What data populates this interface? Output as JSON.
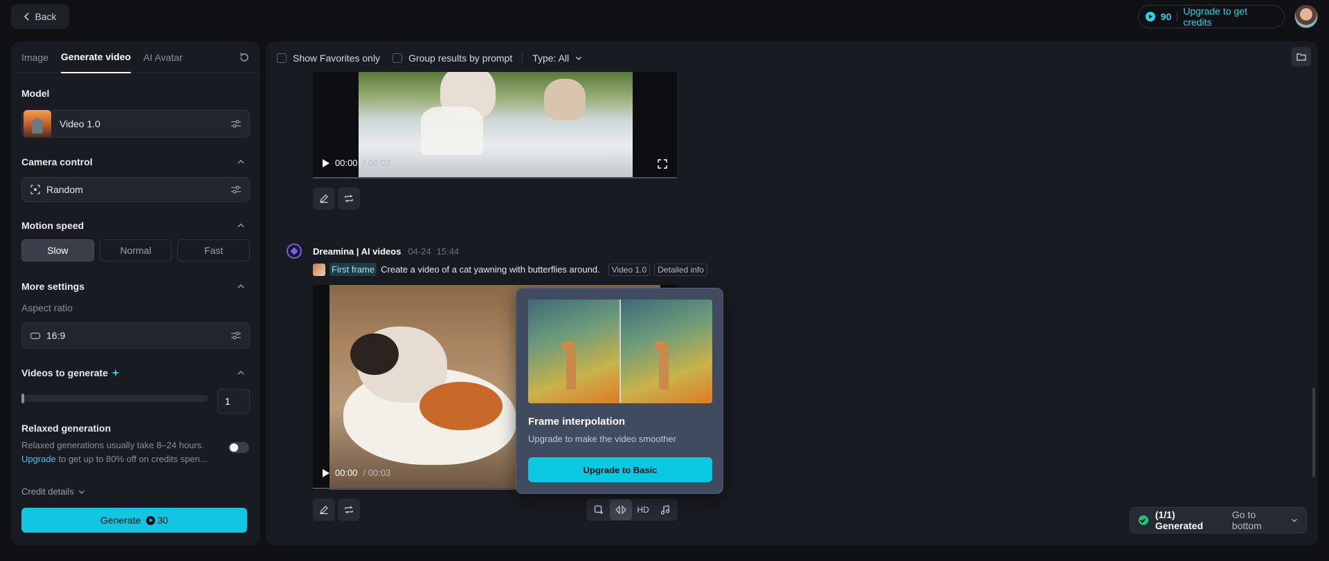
{
  "topbar": {
    "back_label": "Back",
    "credits": "90",
    "upgrade_label": "Upgrade to get credits"
  },
  "left": {
    "tabs": [
      {
        "label": "Image",
        "active": false
      },
      {
        "label": "Generate video",
        "active": true
      },
      {
        "label": "AI Avatar",
        "active": false
      }
    ],
    "model_title": "Model",
    "model_value": "Video 1.0",
    "camera_title": "Camera control",
    "camera_value": "Random",
    "speed_title": "Motion speed",
    "speed_options": [
      "Slow",
      "Normal",
      "Fast"
    ],
    "speed_selected": "Slow",
    "more_title": "More settings",
    "aspect_label": "Aspect ratio",
    "aspect_value": "16:9",
    "videos_title": "Videos to generate",
    "videos_count": "1",
    "relaxed_title": "Relaxed generation",
    "relaxed_desc": "Relaxed generations usually take 8–24 hours.",
    "relaxed_link": "Upgrade",
    "relaxed_desc2": " to get up to 80% off on credits spen...",
    "credit_details": "Credit details",
    "generate_label": "Generate",
    "generate_cost": "30"
  },
  "main": {
    "filter_favorites": "Show Favorites only",
    "filter_group": "Group results by prompt",
    "filter_type": "Type: All",
    "video1": {
      "time": "00:00",
      "duration": "/ 00:03"
    },
    "gen": {
      "name": "Dreamina | AI videos",
      "date": "04-24",
      "time": "15:44",
      "first_frame": "First frame",
      "prompt": "Create a video of a cat yawning with butterflies around.",
      "tag_model": "Video 1.0",
      "tag_info": "Detailed info"
    },
    "video2": {
      "time": "00:00",
      "duration": "/ 00:03"
    },
    "popover": {
      "title": "Frame interpolation",
      "subtitle": "Upgrade to make the video smoother",
      "button": "Upgrade to Basic"
    },
    "tools": {
      "hd": "HD"
    },
    "status": {
      "generated": "(1/1) Generated",
      "goto": "Go to bottom"
    }
  }
}
